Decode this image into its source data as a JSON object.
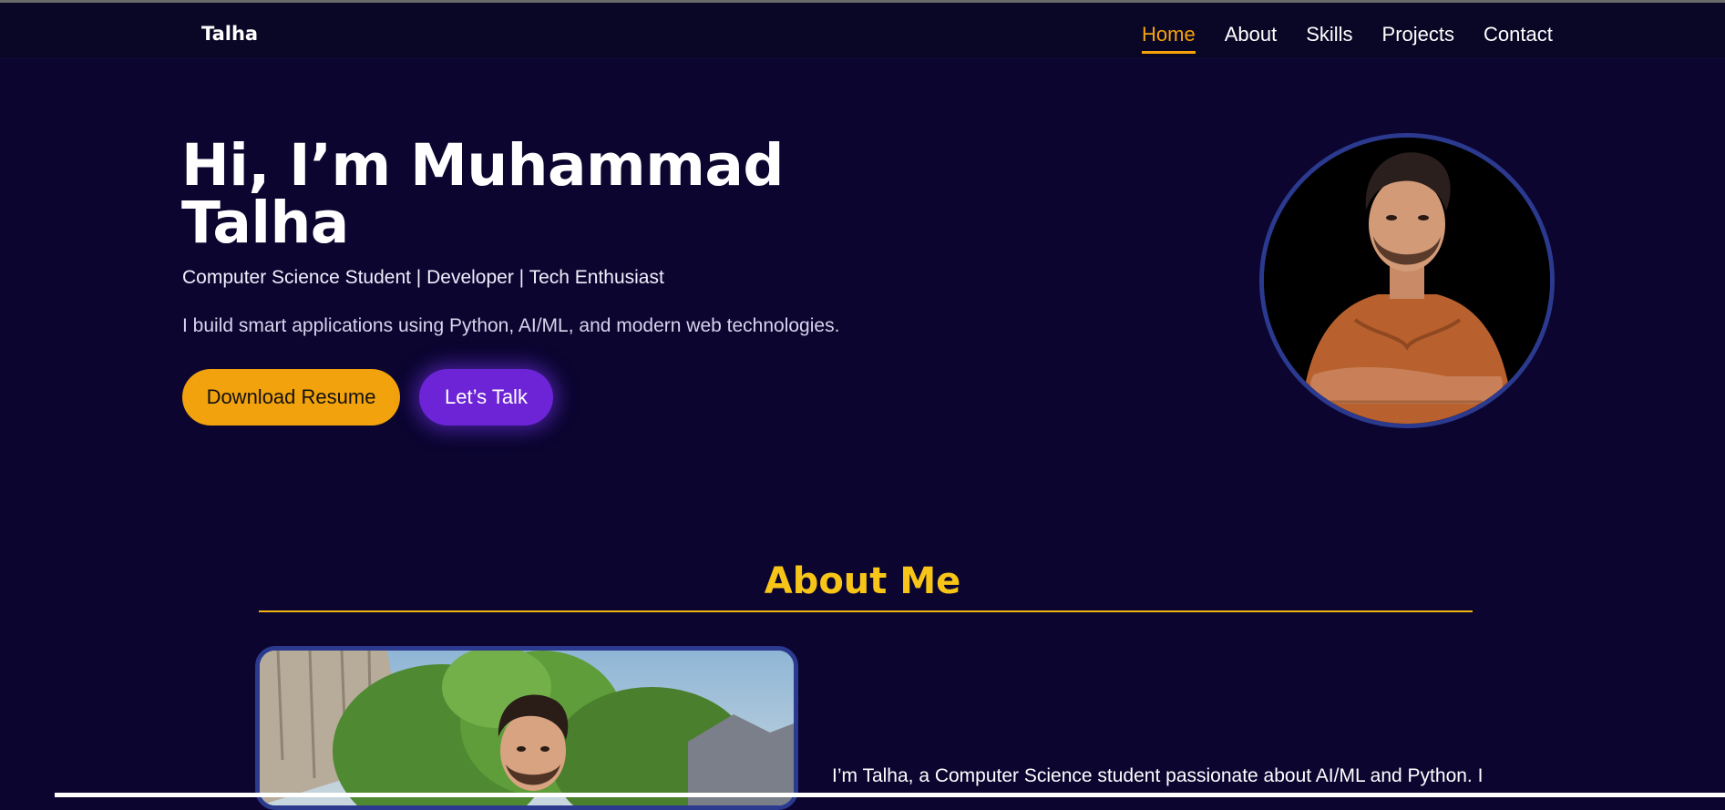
{
  "header": {
    "brand": "Talha",
    "nav": [
      {
        "label": "Home",
        "active": true
      },
      {
        "label": "About",
        "active": false
      },
      {
        "label": "Skills",
        "active": false
      },
      {
        "label": "Projects",
        "active": false
      },
      {
        "label": "Contact",
        "active": false
      }
    ]
  },
  "hero": {
    "title": "Hi, I’m Muhammad Talha",
    "subtitle": "Computer Science Student | Developer | Tech Enthusiast",
    "description": "I build smart applications using Python, AI/ML, and modern web technologies.",
    "download_button": "Download Resume",
    "talk_button": "Let’s Talk"
  },
  "about": {
    "title": "About Me",
    "text": "I’m Talha, a Computer Science student passionate about AI/ML and Python. I"
  },
  "colors": {
    "background": "#0b0530",
    "accent_orange": "#f2a20c",
    "accent_purple": "#6c24d6",
    "heading_yellow": "#f7c518",
    "avatar_border": "#2b3a8f"
  }
}
